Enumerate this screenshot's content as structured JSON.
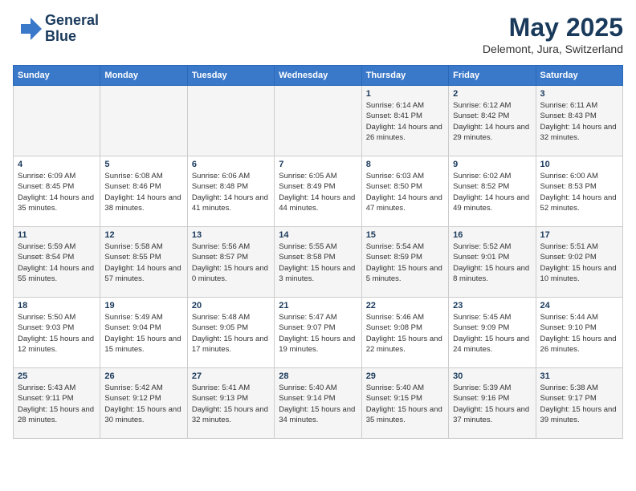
{
  "header": {
    "logo_line1": "General",
    "logo_line2": "Blue",
    "month": "May 2025",
    "location": "Delemont, Jura, Switzerland"
  },
  "days_of_week": [
    "Sunday",
    "Monday",
    "Tuesday",
    "Wednesday",
    "Thursday",
    "Friday",
    "Saturday"
  ],
  "weeks": [
    [
      {
        "day": "",
        "info": ""
      },
      {
        "day": "",
        "info": ""
      },
      {
        "day": "",
        "info": ""
      },
      {
        "day": "",
        "info": ""
      },
      {
        "day": "1",
        "info": "Sunrise: 6:14 AM\nSunset: 8:41 PM\nDaylight: 14 hours\nand 26 minutes."
      },
      {
        "day": "2",
        "info": "Sunrise: 6:12 AM\nSunset: 8:42 PM\nDaylight: 14 hours\nand 29 minutes."
      },
      {
        "day": "3",
        "info": "Sunrise: 6:11 AM\nSunset: 8:43 PM\nDaylight: 14 hours\nand 32 minutes."
      }
    ],
    [
      {
        "day": "4",
        "info": "Sunrise: 6:09 AM\nSunset: 8:45 PM\nDaylight: 14 hours\nand 35 minutes."
      },
      {
        "day": "5",
        "info": "Sunrise: 6:08 AM\nSunset: 8:46 PM\nDaylight: 14 hours\nand 38 minutes."
      },
      {
        "day": "6",
        "info": "Sunrise: 6:06 AM\nSunset: 8:48 PM\nDaylight: 14 hours\nand 41 minutes."
      },
      {
        "day": "7",
        "info": "Sunrise: 6:05 AM\nSunset: 8:49 PM\nDaylight: 14 hours\nand 44 minutes."
      },
      {
        "day": "8",
        "info": "Sunrise: 6:03 AM\nSunset: 8:50 PM\nDaylight: 14 hours\nand 47 minutes."
      },
      {
        "day": "9",
        "info": "Sunrise: 6:02 AM\nSunset: 8:52 PM\nDaylight: 14 hours\nand 49 minutes."
      },
      {
        "day": "10",
        "info": "Sunrise: 6:00 AM\nSunset: 8:53 PM\nDaylight: 14 hours\nand 52 minutes."
      }
    ],
    [
      {
        "day": "11",
        "info": "Sunrise: 5:59 AM\nSunset: 8:54 PM\nDaylight: 14 hours\nand 55 minutes."
      },
      {
        "day": "12",
        "info": "Sunrise: 5:58 AM\nSunset: 8:55 PM\nDaylight: 14 hours\nand 57 minutes."
      },
      {
        "day": "13",
        "info": "Sunrise: 5:56 AM\nSunset: 8:57 PM\nDaylight: 15 hours\nand 0 minutes."
      },
      {
        "day": "14",
        "info": "Sunrise: 5:55 AM\nSunset: 8:58 PM\nDaylight: 15 hours\nand 3 minutes."
      },
      {
        "day": "15",
        "info": "Sunrise: 5:54 AM\nSunset: 8:59 PM\nDaylight: 15 hours\nand 5 minutes."
      },
      {
        "day": "16",
        "info": "Sunrise: 5:52 AM\nSunset: 9:01 PM\nDaylight: 15 hours\nand 8 minutes."
      },
      {
        "day": "17",
        "info": "Sunrise: 5:51 AM\nSunset: 9:02 PM\nDaylight: 15 hours\nand 10 minutes."
      }
    ],
    [
      {
        "day": "18",
        "info": "Sunrise: 5:50 AM\nSunset: 9:03 PM\nDaylight: 15 hours\nand 12 minutes."
      },
      {
        "day": "19",
        "info": "Sunrise: 5:49 AM\nSunset: 9:04 PM\nDaylight: 15 hours\nand 15 minutes."
      },
      {
        "day": "20",
        "info": "Sunrise: 5:48 AM\nSunset: 9:05 PM\nDaylight: 15 hours\nand 17 minutes."
      },
      {
        "day": "21",
        "info": "Sunrise: 5:47 AM\nSunset: 9:07 PM\nDaylight: 15 hours\nand 19 minutes."
      },
      {
        "day": "22",
        "info": "Sunrise: 5:46 AM\nSunset: 9:08 PM\nDaylight: 15 hours\nand 22 minutes."
      },
      {
        "day": "23",
        "info": "Sunrise: 5:45 AM\nSunset: 9:09 PM\nDaylight: 15 hours\nand 24 minutes."
      },
      {
        "day": "24",
        "info": "Sunrise: 5:44 AM\nSunset: 9:10 PM\nDaylight: 15 hours\nand 26 minutes."
      }
    ],
    [
      {
        "day": "25",
        "info": "Sunrise: 5:43 AM\nSunset: 9:11 PM\nDaylight: 15 hours\nand 28 minutes."
      },
      {
        "day": "26",
        "info": "Sunrise: 5:42 AM\nSunset: 9:12 PM\nDaylight: 15 hours\nand 30 minutes."
      },
      {
        "day": "27",
        "info": "Sunrise: 5:41 AM\nSunset: 9:13 PM\nDaylight: 15 hours\nand 32 minutes."
      },
      {
        "day": "28",
        "info": "Sunrise: 5:40 AM\nSunset: 9:14 PM\nDaylight: 15 hours\nand 34 minutes."
      },
      {
        "day": "29",
        "info": "Sunrise: 5:40 AM\nSunset: 9:15 PM\nDaylight: 15 hours\nand 35 minutes."
      },
      {
        "day": "30",
        "info": "Sunrise: 5:39 AM\nSunset: 9:16 PM\nDaylight: 15 hours\nand 37 minutes."
      },
      {
        "day": "31",
        "info": "Sunrise: 5:38 AM\nSunset: 9:17 PM\nDaylight: 15 hours\nand 39 minutes."
      }
    ]
  ]
}
